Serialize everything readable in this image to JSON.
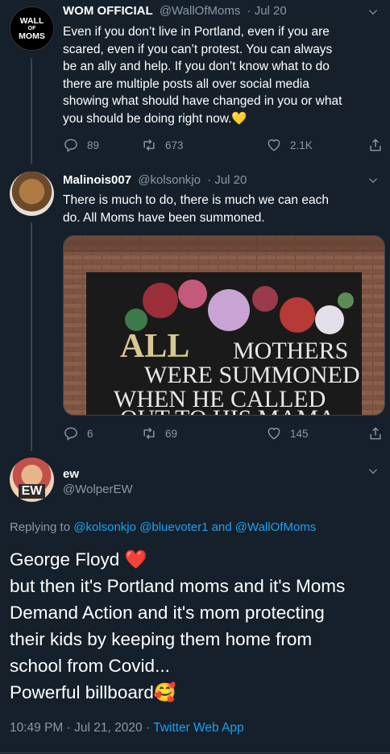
{
  "tweets": [
    {
      "name": "WOM OFFICIAL",
      "handle": "@WallOfMoms",
      "date": "Jul 20",
      "avatar_text": [
        "WALL",
        "OF",
        "MOMS"
      ],
      "lines": [
        "Even if you don’t live in Portland, even if you are",
        "scared, even if you can’t protest. You can always",
        "be an ally and help. If you don’t know what to do",
        "there are multiple posts all over social media",
        "showing what should have changed in you or what",
        "you should be doing right now.💛"
      ],
      "replies": "89",
      "retweets": "673",
      "likes": "2.1K"
    },
    {
      "name": "Malinois007",
      "handle": "@kolsonkjo",
      "date": "Jul 20",
      "lines": [
        "There is much to do, there is much we can each",
        "do.  All Moms have been summoned."
      ],
      "image_text": [
        "ALL",
        "MOTHERS",
        "WERE SUMMONED",
        "WHEN HE CALLED",
        "OUT TO HIS MAMA"
      ],
      "replies": "6",
      "retweets": "69",
      "likes": "145"
    }
  ],
  "main_tweet": {
    "name": "ew",
    "handle": "@WolperEW",
    "avatar_text": "EW",
    "replying_prefix": "Replying to",
    "replying_to": "@kolsonkjo @bluevoter1 and @WallOfMoms",
    "lines": [
      "George Floyd ❤️",
      "but then it's Portland moms and it's Moms",
      "Demand Action and it's mom protecting",
      "their kids by keeping them home from",
      "school from Covid...",
      "Powerful billboard🥰"
    ],
    "timestamp": "10:49 PM · Jul 21, 2020 ·",
    "source": "Twitter Web App"
  },
  "colors": {
    "background": "#15202b",
    "secondary_text": "#8899a6",
    "link": "#1da1f2",
    "border": "#38444d"
  },
  "icons": [
    "reply-icon",
    "retweet-icon",
    "like-icon",
    "share-icon",
    "caret-down-icon"
  ]
}
